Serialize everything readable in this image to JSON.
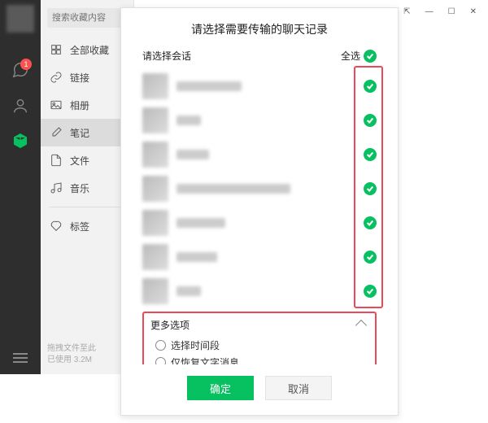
{
  "rail": {
    "badge": "1"
  },
  "sidebar": {
    "search_placeholder": "搜索收藏内容",
    "items": [
      "全部收藏",
      "链接",
      "相册",
      "笔记",
      "文件",
      "音乐",
      "标签"
    ],
    "active_index": 3,
    "footer_line1": "拖拽文件至此",
    "footer_line2": "已使用 3.2M"
  },
  "modal": {
    "title": "请选择需要传输的聊天记录",
    "select_label": "请选择会话",
    "select_all": "全选",
    "chat_widths": [
      80,
      30,
      40,
      140,
      60,
      50,
      30
    ],
    "more_label": "更多选项",
    "opt_time": "选择时间段",
    "opt_text": "仅恢复文字消息",
    "ok": "确定",
    "cancel": "取消"
  }
}
